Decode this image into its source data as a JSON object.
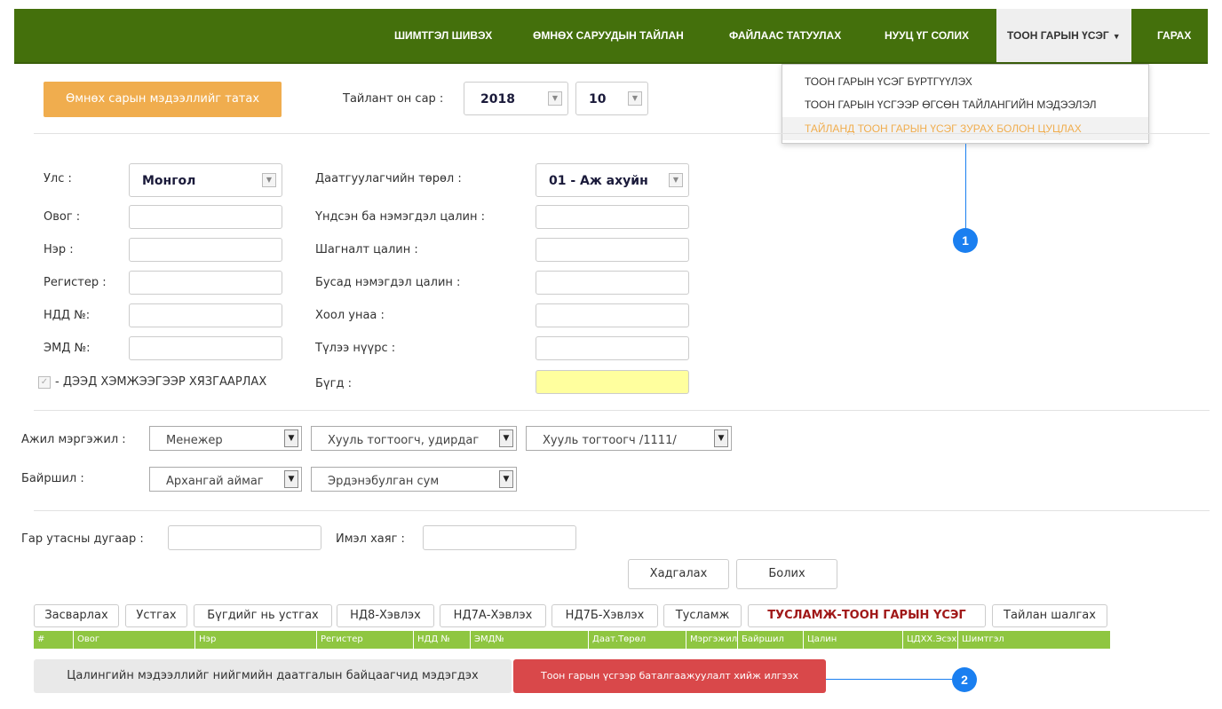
{
  "nav": {
    "items": [
      "ШИМТГЭЛ ШИВЭХ",
      "ӨМНӨХ САРУУДЫН ТАЙЛАН",
      "ФАЙЛААС ТАТУУЛАХ",
      "НУУЦ ҮГ СОЛИХ"
    ],
    "active": "ТООН ГАРЫН ҮСЭГ",
    "exit": "ГАРАХ"
  },
  "dropdown": {
    "items": [
      "ТООН ГАРЫН ҮСЭГ БҮРТГҮҮЛЭХ",
      "ТООН ГАРЫН ҮСГЭЭР ӨГСӨН ТАЙЛАНГИЙН МЭДЭЭЛЭЛ",
      "ТАЙЛАНД ТООН ГАРЫН ҮСЭГ ЗУРАХ БОЛОН ЦУЦЛАХ"
    ]
  },
  "callouts": [
    "1",
    "2"
  ],
  "header": {
    "fetch_prev_btn": "Өмнөх сарын мэдээллийг татах",
    "report_period_label": "Тайлант он сар :",
    "year": "2018",
    "month": "10"
  },
  "form_left": {
    "country_label": "Улс :",
    "country_value": "Монгол",
    "labels": [
      "Овог :",
      "Нэр :",
      "Регистер :",
      "НДД №:",
      "ЭМД №:"
    ],
    "max_limit_label": "- ДЭЭД ХЭМЖЭЭГЭЭР ХЯЗГААРЛАХ"
  },
  "form_right": {
    "insured_type_label": "Даатгуулагчийн төрөл :",
    "insured_type_value": "01 - Аж ахуйн",
    "labels": [
      "Үндсэн ба нэмэгдэл цалин :",
      "Шагналт цалин :",
      "Бусад нэмэгдэл цалин :",
      "Хоол унаа :",
      "Түлээ нүүрс :"
    ],
    "total_label": "Бүгд :"
  },
  "job": {
    "label": "Ажил мэргэжил :",
    "values": [
      "Менежер",
      "Хууль тогтоогч, удирдаг",
      "Хууль тогтоогч /1111/"
    ]
  },
  "location": {
    "label": "Байршил :",
    "values": [
      "Архангай аймаг",
      "Эрдэнэбулган сум"
    ]
  },
  "contact": {
    "phone_label": "Гар утасны дугаар :",
    "email_label": "Имэл хаяг :"
  },
  "actions": {
    "save": "Хадгалах",
    "cancel": "Болих"
  },
  "toolbar": [
    "Засварлах",
    "Устгах",
    "Бүгдийг нь устгах",
    "НД8-Хэвлэх",
    "НД7А-Хэвлэх",
    "НД7Б-Хэвлэх",
    "Тусламж",
    "ТУСЛАМЖ-ТООН ГАРЫН ҮСЭГ",
    "Тайлан шалгах"
  ],
  "table": {
    "columns": [
      "#",
      "Овог",
      "Нэр",
      "Регистер",
      "НДД №",
      "ЭМД№",
      "Даат.Төрөл",
      "Мэргэжил",
      "Байршил",
      "Цалин",
      "ЦДХХ.Эсэх",
      "Шимтгэл"
    ]
  },
  "bottom": {
    "inspector_btn": "Цалингийн мэдээллийг нийгмийн даатгалын байцаагчид мэдэгдэх",
    "digital_sign_btn": "Тоон гарын үсгээр баталгаажуулалт хийж илгээх"
  },
  "colors": {
    "nav_bg": "#44700c",
    "table_header": "#8fc641",
    "orange": "#f0ad4e",
    "red": "#d9484a",
    "callout": "#1a7ff0"
  }
}
